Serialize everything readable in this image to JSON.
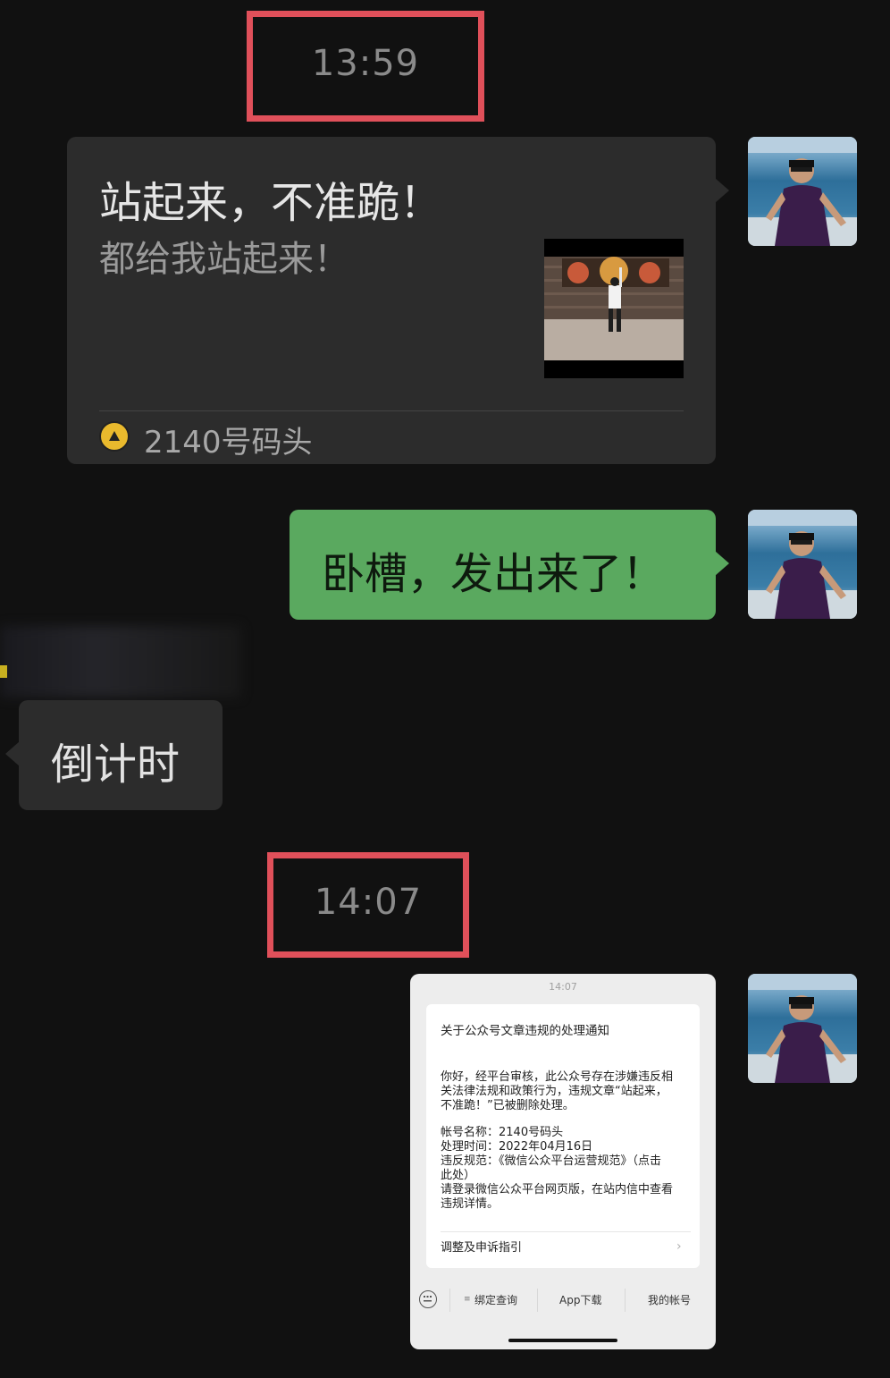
{
  "timestamps": {
    "first": "13:59",
    "second": "14:07"
  },
  "article_card": {
    "title": "站起来，不准跪！",
    "subtitle": "都给我站起来！",
    "source": "2140号码头"
  },
  "messages": {
    "sent_text": "卧槽，发出来了！",
    "received_text": "倒计时"
  },
  "notice": {
    "time": "14:07",
    "title": "关于公众号文章违规的处理通知",
    "body_lines": [
      "你好，经平台审核，此公众号存在涉嫌违反相",
      "关法律法规和政策行为，违规文章“站起来，",
      "不准跪！”已被删除处理。"
    ],
    "detail_lines": [
      "帐号名称：2140号码头",
      "处理时间：2022年04月16日",
      "违反规范：《微信公众平台运营规范》（点击",
      "此处）",
      "请登录微信公众平台网页版，在站内信中查看",
      "违规详情。"
    ],
    "guide_link": "调整及申诉指引",
    "menu": [
      "绑定查询",
      "App下载",
      "我的帐号"
    ]
  },
  "colors": {
    "background": "#111111",
    "bubble_gray": "#2c2c2c",
    "bubble_green": "#5aa95f",
    "highlight_red": "#e0505a"
  }
}
